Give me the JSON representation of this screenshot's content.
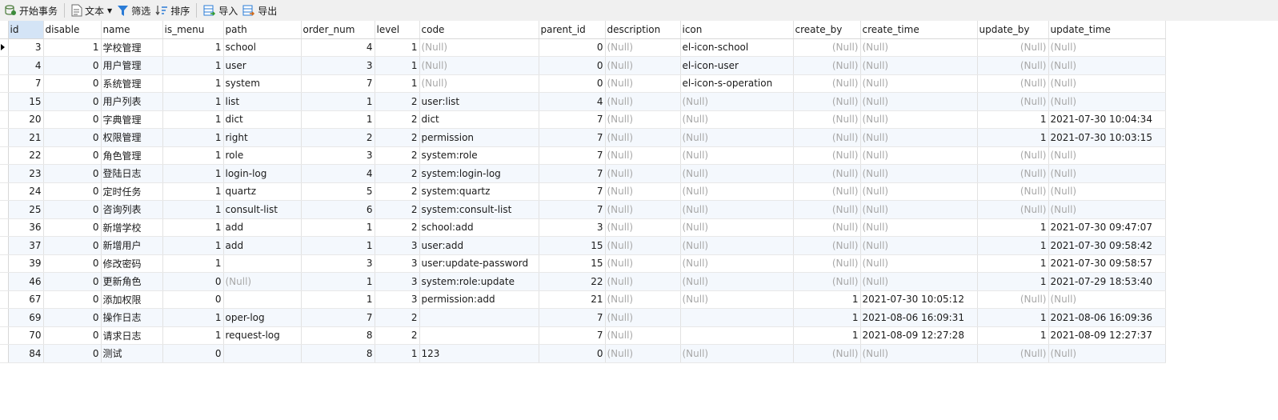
{
  "toolbar": {
    "begin_tx": "开始事务",
    "text": "文本",
    "filter": "筛选",
    "sort": "排序",
    "import": "导入",
    "export": "导出"
  },
  "columns": [
    "id",
    "disable",
    "name",
    "is_menu",
    "path",
    "order_num",
    "level",
    "code",
    "parent_id",
    "description",
    "icon",
    "create_by",
    "create_time",
    "update_by",
    "update_time"
  ],
  "selected_column": "id",
  "selected_row": 0,
  "rows": [
    [
      "3",
      "1",
      "学校管理",
      "1",
      "school",
      "4",
      "1",
      null,
      "0",
      null,
      "el-icon-school",
      null,
      null,
      null,
      null
    ],
    [
      "4",
      "0",
      "用户管理",
      "1",
      "user",
      "3",
      "1",
      null,
      "0",
      null,
      "el-icon-user",
      null,
      null,
      null,
      null
    ],
    [
      "7",
      "0",
      "系统管理",
      "1",
      "system",
      "7",
      "1",
      null,
      "0",
      null,
      "el-icon-s-operation",
      null,
      null,
      null,
      null
    ],
    [
      "15",
      "0",
      "用户列表",
      "1",
      "list",
      "1",
      "2",
      "user:list",
      "4",
      null,
      null,
      null,
      null,
      null,
      null
    ],
    [
      "20",
      "0",
      "字典管理",
      "1",
      "dict",
      "1",
      "2",
      "dict",
      "7",
      null,
      null,
      null,
      null,
      "1",
      "2021-07-30 10:04:34"
    ],
    [
      "21",
      "0",
      "权限管理",
      "1",
      "right",
      "2",
      "2",
      "permission",
      "7",
      null,
      null,
      null,
      null,
      "1",
      "2021-07-30 10:03:15"
    ],
    [
      "22",
      "0",
      "角色管理",
      "1",
      "role",
      "3",
      "2",
      "system:role",
      "7",
      null,
      null,
      null,
      null,
      null,
      null
    ],
    [
      "23",
      "0",
      "登陆日志",
      "1",
      "login-log",
      "4",
      "2",
      "system:login-log",
      "7",
      null,
      null,
      null,
      null,
      null,
      null
    ],
    [
      "24",
      "0",
      "定时任务",
      "1",
      "quartz",
      "5",
      "2",
      "system:quartz",
      "7",
      null,
      null,
      null,
      null,
      null,
      null
    ],
    [
      "25",
      "0",
      "咨询列表",
      "1",
      "consult-list",
      "6",
      "2",
      "system:consult-list",
      "7",
      null,
      null,
      null,
      null,
      null,
      null
    ],
    [
      "36",
      "0",
      "新增学校",
      "1",
      "add",
      "1",
      "2",
      "school:add",
      "3",
      null,
      null,
      null,
      null,
      "1",
      "2021-07-30 09:47:07"
    ],
    [
      "37",
      "0",
      "新增用户",
      "1",
      "add",
      "1",
      "3",
      "user:add",
      "15",
      null,
      null,
      null,
      null,
      "1",
      "2021-07-30 09:58:42"
    ],
    [
      "39",
      "0",
      "修改密码",
      "1",
      "",
      "3",
      "3",
      "user:update-password",
      "15",
      null,
      null,
      null,
      null,
      "1",
      "2021-07-30 09:58:57"
    ],
    [
      "46",
      "0",
      "更新角色",
      "0",
      null,
      "1",
      "3",
      "system:role:update",
      "22",
      null,
      null,
      null,
      null,
      "1",
      "2021-07-29 18:53:40"
    ],
    [
      "67",
      "0",
      "添加权限",
      "0",
      "",
      "1",
      "3",
      "permission:add",
      "21",
      null,
      null,
      "1",
      "2021-07-30 10:05:12",
      null,
      null
    ],
    [
      "69",
      "0",
      "操作日志",
      "1",
      "oper-log",
      "7",
      "2",
      "",
      "7",
      null,
      "",
      "1",
      "2021-08-06 16:09:31",
      "1",
      "2021-08-06 16:09:36"
    ],
    [
      "70",
      "0",
      "请求日志",
      "1",
      "request-log",
      "8",
      "2",
      "",
      "7",
      null,
      "",
      "1",
      "2021-08-09 12:27:28",
      "1",
      "2021-08-09 12:27:37"
    ],
    [
      "84",
      "0",
      "测试",
      "0",
      "",
      "8",
      "1",
      "123",
      "0",
      null,
      null,
      null,
      null,
      null,
      null
    ]
  ],
  "null_text": "(Null)"
}
